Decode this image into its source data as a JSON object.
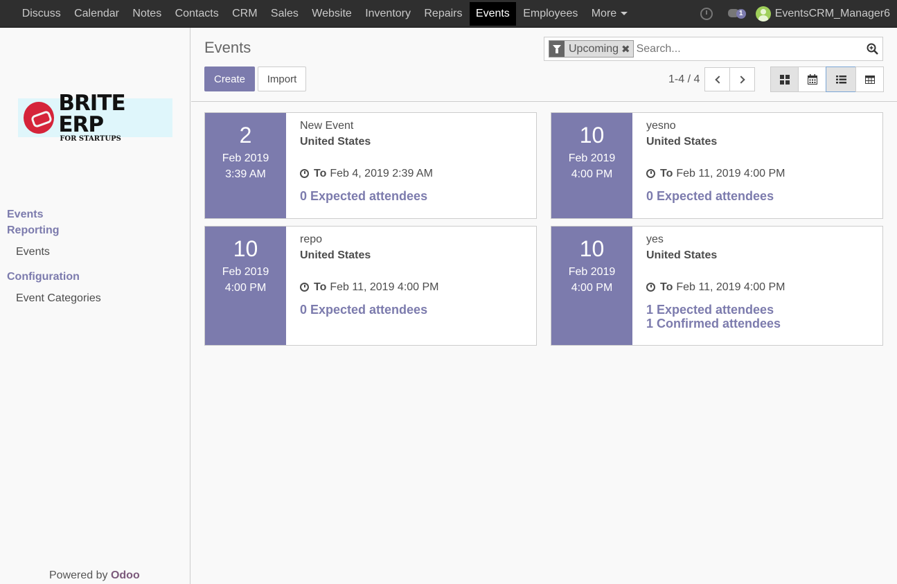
{
  "topbar": {
    "menu": [
      "Discuss",
      "Calendar",
      "Notes",
      "Contacts",
      "CRM",
      "Sales",
      "Website",
      "Inventory",
      "Repairs",
      "Events",
      "Employees"
    ],
    "more_label": "More",
    "chat_count": "1",
    "user_name": "EventsCRM_Manager6"
  },
  "sidebar": {
    "logo_title": "BRITE ERP",
    "logo_subtitle": "FOR STARTUPS",
    "sections": {
      "events": "Events",
      "reporting": "Reporting",
      "reporting_events": "Events",
      "configuration": "Configuration",
      "event_categories": "Event Categories"
    },
    "powered_by": "Powered by",
    "odoo": "Odoo"
  },
  "control": {
    "title": "Events",
    "facet_label": "Upcoming",
    "search_placeholder": "Search...",
    "create_label": "Create",
    "import_label": "Import",
    "pager": "1-4 / 4"
  },
  "events": [
    {
      "day": "2",
      "month": "Feb 2019",
      "time": "3:39 AM",
      "name": "New Event",
      "country": "United States",
      "to_label": "To",
      "to_date": "Feb 4, 2019 2:39 AM",
      "expected": "0 Expected attendees",
      "confirmed": ""
    },
    {
      "day": "10",
      "month": "Feb 2019",
      "time": "4:00 PM",
      "name": "yesno",
      "country": "United States",
      "to_label": "To",
      "to_date": "Feb 11, 2019 4:00 PM",
      "expected": "0 Expected attendees",
      "confirmed": ""
    },
    {
      "day": "10",
      "month": "Feb 2019",
      "time": "4:00 PM",
      "name": "repo",
      "country": "United States",
      "to_label": "To",
      "to_date": "Feb 11, 2019 4:00 PM",
      "expected": "0 Expected attendees",
      "confirmed": ""
    },
    {
      "day": "10",
      "month": "Feb 2019",
      "time": "4:00 PM",
      "name": "yes",
      "country": "United States",
      "to_label": "To",
      "to_date": "Feb 11, 2019 4:00 PM",
      "expected": "1 Expected attendees",
      "confirmed": "1 Confirmed attendees"
    }
  ],
  "colors": {
    "brand": "#7c7bad",
    "navbar": "#2f2f2f",
    "logo_red": "#d5243a"
  },
  "icons": [
    "clock-icon",
    "chat-icon",
    "avatar",
    "filter-icon",
    "close-icon",
    "search-icon",
    "chevron-left-icon",
    "chevron-right-icon",
    "kanban-view-icon",
    "calendar-view-icon",
    "list-view-icon",
    "grid-view-icon"
  ]
}
